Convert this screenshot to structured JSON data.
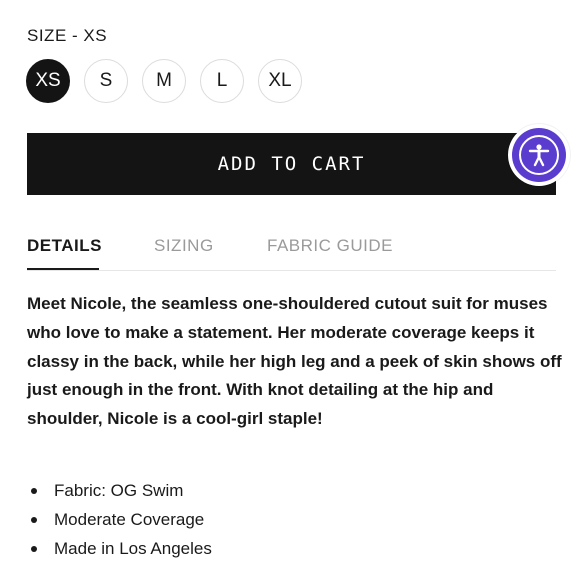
{
  "size_section": {
    "label": "SIZE - XS",
    "options": [
      "XS",
      "S",
      "M",
      "L",
      "XL"
    ],
    "selected": "XS"
  },
  "cart": {
    "add_label": "ADD TO CART"
  },
  "accessibility": {
    "icon": "accessibility-person-icon",
    "color": "#5a3ccf"
  },
  "tabs": [
    {
      "label": "DETAILS",
      "active": true
    },
    {
      "label": "SIZING",
      "active": false
    },
    {
      "label": "FABRIC GUIDE",
      "active": false
    }
  ],
  "details": {
    "description": "Meet Nicole, the seamless one-shouldered cutout suit for muses who love to make a statement. Her moderate coverage keeps it classy in the back, while her high leg and a peek of skin shows off just enough in the front. With knot detailing at the hip and shoulder, Nicole is a cool-girl staple!",
    "bullets": [
      "Fabric: OG Swim",
      "Moderate Coverage",
      "Made in Los Angeles"
    ]
  }
}
